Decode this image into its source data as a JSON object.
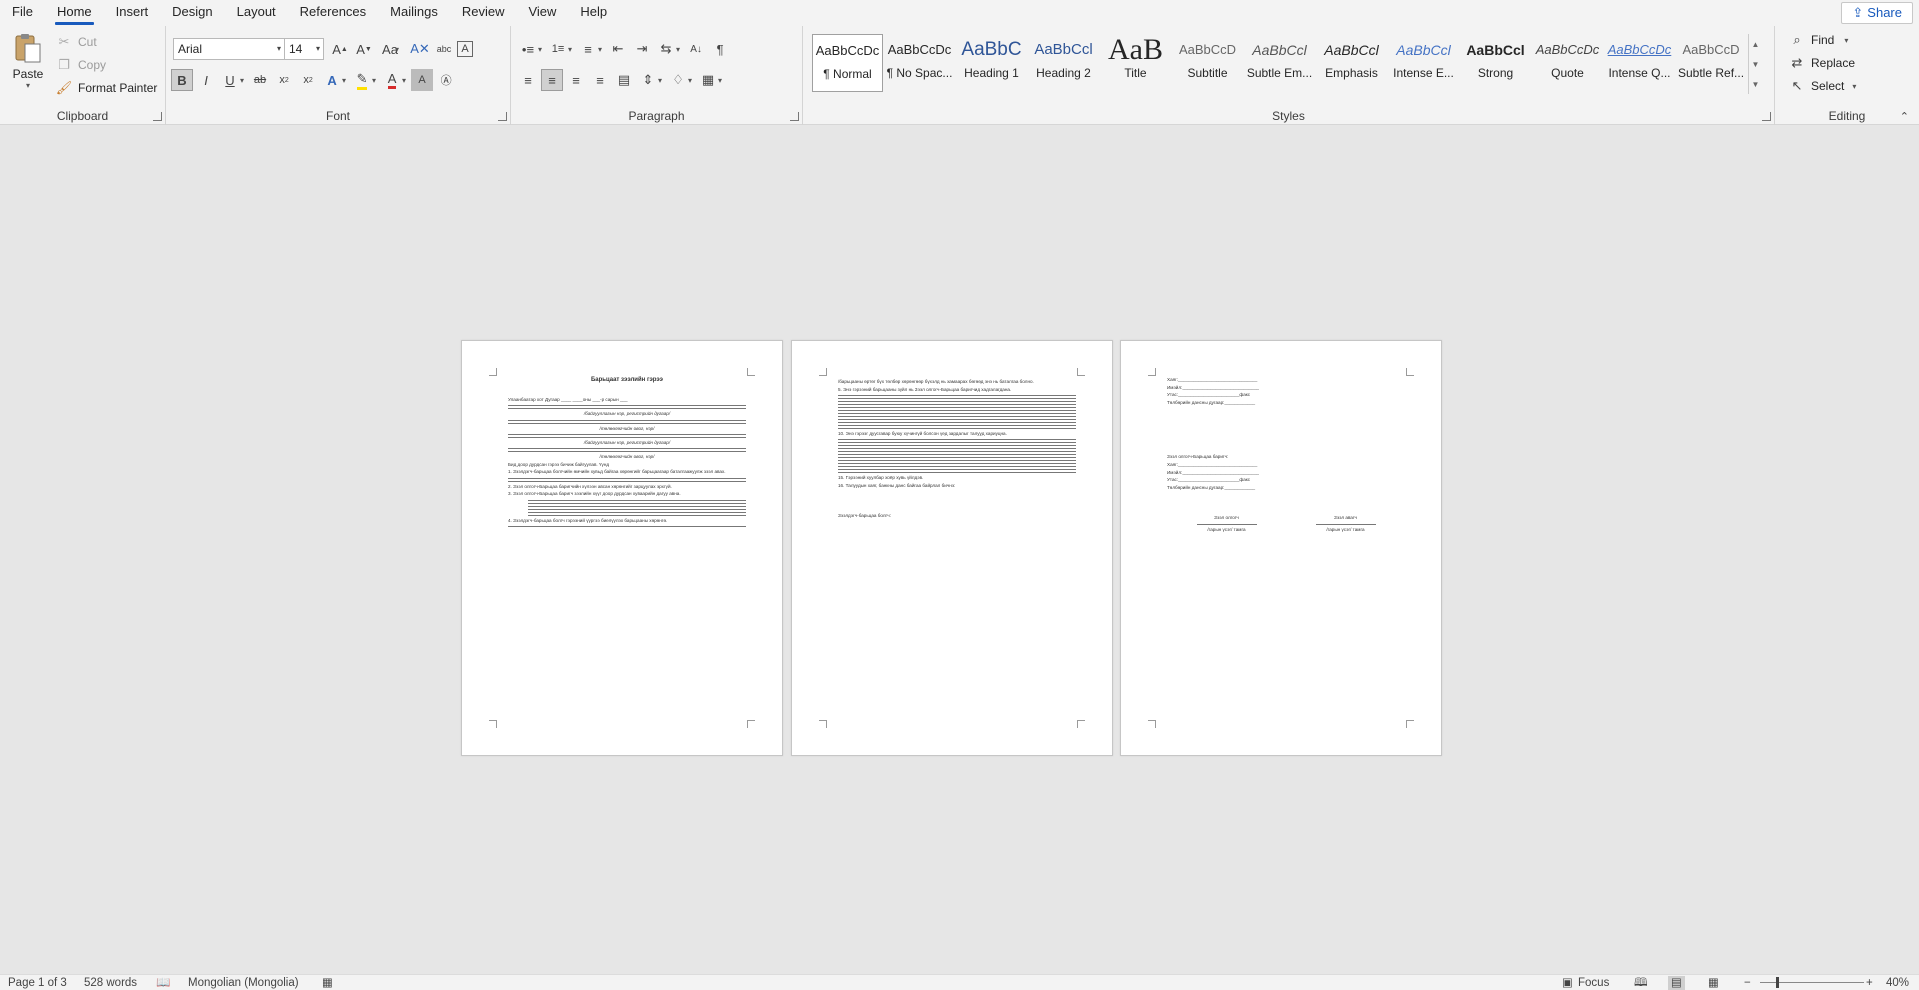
{
  "menu": {
    "tabs": [
      "File",
      "Home",
      "Insert",
      "Design",
      "Layout",
      "References",
      "Mailings",
      "Review",
      "View",
      "Help"
    ],
    "active_tab": "Home",
    "share": "Share"
  },
  "clipboard": {
    "paste": "Paste",
    "cut": "Cut",
    "copy": "Copy",
    "format_painter": "Format Painter",
    "label": "Clipboard"
  },
  "font": {
    "family": "Arial",
    "size": "14",
    "label": "Font",
    "font_color": "#d62c2c",
    "highlight_color": "#ffe000"
  },
  "paragraph": {
    "label": "Paragraph"
  },
  "styles": {
    "label": "Styles",
    "items": [
      {
        "preview": "AaBbCcDc",
        "name": "¶ Normal"
      },
      {
        "preview": "AaBbCcDc",
        "name": "¶ No Spac..."
      },
      {
        "preview": "AaBbC",
        "name": "Heading 1"
      },
      {
        "preview": "AaBbCcl",
        "name": "Heading 2"
      },
      {
        "preview": "AaB",
        "name": "Title"
      },
      {
        "preview": "AaBbCcD",
        "name": "Subtitle"
      },
      {
        "preview": "AaBbCcl",
        "name": "Subtle Em..."
      },
      {
        "preview": "AaBbCcl",
        "name": "Emphasis"
      },
      {
        "preview": "AaBbCcl",
        "name": "Intense E..."
      },
      {
        "preview": "AaBbCcl",
        "name": "Strong"
      },
      {
        "preview": "AaBbCcDc",
        "name": "Quote"
      },
      {
        "preview": "AaBbCcDc",
        "name": "Intense Q..."
      },
      {
        "preview": "AaBbCcD",
        "name": "Subtle Ref..."
      }
    ]
  },
  "editing": {
    "label": "Editing",
    "find": "Find",
    "replace": "Replace",
    "select": "Select"
  },
  "document": {
    "page1": {
      "title": "Барьцаат зээлийн гэрээ",
      "line1": "Улаанбаатар хот                  Дугаар ____              ____оны ___-р сарын ___",
      "caption1": "/байгууллагын нэр, регистрийн дугаар/",
      "caption2": "/төлөөлөгчийн овог, нэр/",
      "intro": "Бид доор дурдсан гэрээ бичиж байгуулав. Үүнд",
      "item1": "1. Зээлдэгч-барьцаа болгчийн өмчийн хувьд байгаа хөрөнгийг барьцаагаар баталгаажуулж зээл авах.",
      "item2": "2. Зээл олгогч-Барьцаа баригчийн хүлээн авсан хөрөнгийг зарцуулах эрхгүй.",
      "item3": "3. Зээл олгогч-Барьцаа баригч зээлийн хүүг доор дурдсан хуваарийн дагуу авна.",
      "item4": "4. Зээлдэгч-барьцаа болгч гэрээний үүргээ биелүүлэх барьцааны хөрөнгө."
    },
    "page2": {
      "p1": "/барьцааны өртөг бүх төлбөр хөрөнгөөр бүхэлд нь хамаарах бөгөөд энэ нь баталгаа болно.",
      "p2": "5. Энэ гэрээний барьцааны зүйл нь Зээл олгогч-Барьцаа баригчид хадгалагдана.",
      "p3": "10. Энэ гэрээг дуусгавар буюу хүчингүй болсон үед зардалыг талууд хариуцна.",
      "p4": "15. Гэрээний хуулбар хоёр хувь үйлдэв.",
      "p5": "16. Талуудын хаяг, банкны данс байгаа байрлал бичнэ:",
      "sign": "Зээлдэгч-барьцаа болгч:"
    },
    "page3": {
      "l1": "Хаяг:_______________________________",
      "l2": "Имэйл:______________________________",
      "l3": "Утас:________________________факс",
      "l4": "Төлбөрийн дансны дугаар:____________",
      "head2": "Зээл олгогч-Барьцаа баригч:",
      "sig1": "Зээл олгогч",
      "sig2": "Зээл авагч",
      "sigcap": "/гарын үсэг/ тамга"
    }
  },
  "status": {
    "page": "Page 1 of 3",
    "words": "528 words",
    "language": "Mongolian (Mongolia)",
    "focus": "Focus",
    "zoom": "40%"
  }
}
